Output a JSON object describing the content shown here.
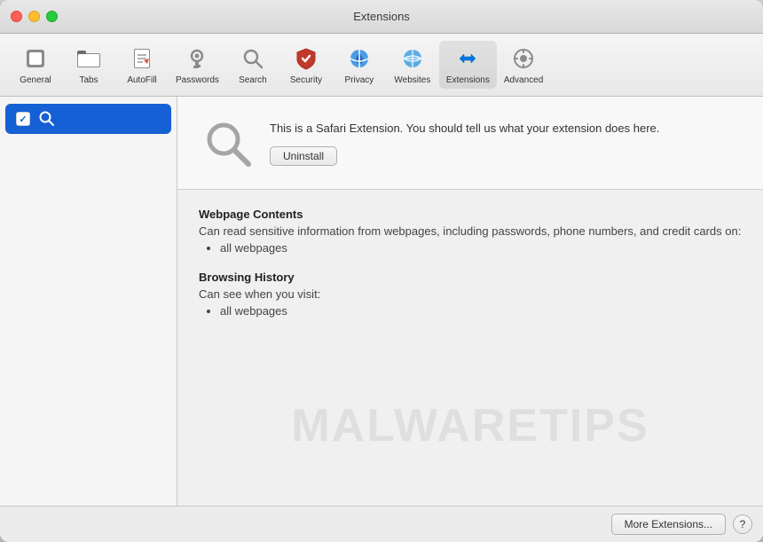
{
  "window": {
    "title": "Extensions"
  },
  "toolbar": {
    "items": [
      {
        "id": "general",
        "label": "General",
        "icon": "general"
      },
      {
        "id": "tabs",
        "label": "Tabs",
        "icon": "tabs"
      },
      {
        "id": "autofill",
        "label": "AutoFill",
        "icon": "autofill"
      },
      {
        "id": "passwords",
        "label": "Passwords",
        "icon": "passwords"
      },
      {
        "id": "search",
        "label": "Search",
        "icon": "search"
      },
      {
        "id": "security",
        "label": "Security",
        "icon": "security"
      },
      {
        "id": "privacy",
        "label": "Privacy",
        "icon": "privacy"
      },
      {
        "id": "websites",
        "label": "Websites",
        "icon": "websites"
      },
      {
        "id": "extensions",
        "label": "Extensions",
        "icon": "extensions",
        "active": true
      },
      {
        "id": "advanced",
        "label": "Advanced",
        "icon": "advanced"
      }
    ]
  },
  "sidebar": {
    "items": [
      {
        "id": "search-ext",
        "label": "Search",
        "enabled": true
      }
    ]
  },
  "extension": {
    "description": "This is a Safari Extension. You should tell us what your extension does here.",
    "uninstall_label": "Uninstall"
  },
  "permissions": {
    "sections": [
      {
        "title": "Webpage Contents",
        "description": "Can read sensitive information from webpages, including passwords, phone numbers, and credit cards on:",
        "items": [
          "all webpages"
        ]
      },
      {
        "title": "Browsing History",
        "description": "Can see when you visit:",
        "items": [
          "all webpages"
        ]
      }
    ]
  },
  "bottom_bar": {
    "more_extensions_label": "More Extensions...",
    "help_label": "?"
  },
  "watermark": "MALWARETIPS"
}
